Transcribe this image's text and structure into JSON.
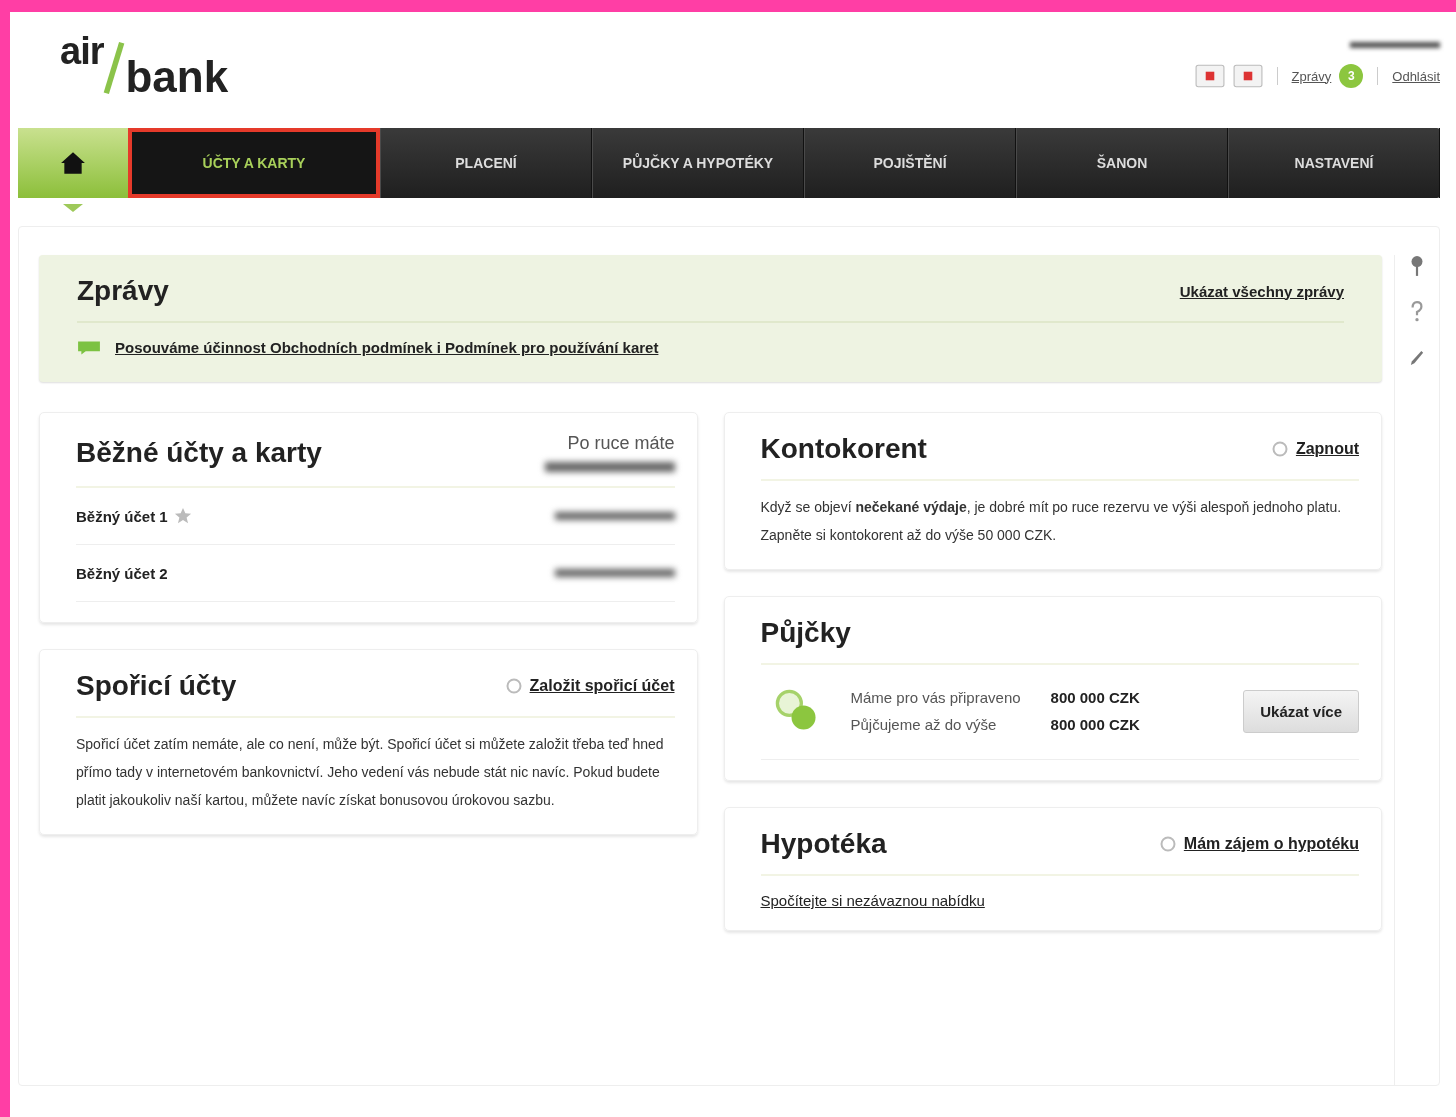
{
  "header": {
    "logo_top": "air",
    "logo_bottom": "bank",
    "messages_label": "Zprávy",
    "messages_count": "3",
    "logout": "Odhlásit"
  },
  "nav": [
    {
      "kind": "home",
      "selected": true,
      "highlighted": false
    },
    {
      "label": "ÚČTY A KARTY",
      "selected": false,
      "highlighted": true
    },
    {
      "label": "PLACENÍ",
      "selected": false,
      "highlighted": false
    },
    {
      "label": "PŮJČKY A HYPOTÉKY",
      "selected": false,
      "highlighted": false
    },
    {
      "label": "POJIŠTĚNÍ",
      "selected": false,
      "highlighted": false
    },
    {
      "label": "ŠANON",
      "selected": false,
      "highlighted": false
    },
    {
      "label": "NASTAVENÍ",
      "selected": false,
      "highlighted": false
    }
  ],
  "messages": {
    "title": "Zprávy",
    "link": "Ukázat všechny zprávy",
    "items": [
      "Posouváme účinnost Obchodních podmínek i Podmínek pro používání karet"
    ]
  },
  "current_accounts": {
    "title": "Běžné účty a karty",
    "available_label": "Po ruce máte",
    "accounts": [
      {
        "name": "Běžný účet 1",
        "favorite": true
      },
      {
        "name": "Běžný účet 2",
        "favorite": false
      }
    ]
  },
  "savings": {
    "title": "Spořicí účty",
    "action": "Založit spořicí účet",
    "text": "Spořicí účet zatím nemáte, ale co není, může být. Spořicí účet si můžete založit třeba teď hned přímo tady v internetovém bankovnictví. Jeho vedení vás nebude stát nic navíc. Pokud budete platit jakoukoliv naší kartou, můžete navíc získat bonusovou úrokovou sazbu."
  },
  "overdraft": {
    "title": "Kontokorent",
    "action": "Zapnout",
    "text": "Když se objeví **nečekané výdaje**, je dobré mít po ruce rezervu ve výši alespoň jednoho platu. Zapněte si kontokorent až do výše 50 000 CZK."
  },
  "loans": {
    "title": "Půjčky",
    "rows": [
      {
        "label": "Máme pro vás připraveno",
        "value": "800 000 CZK"
      },
      {
        "label": "Půjčujeme až do výše",
        "value": "800 000 CZK"
      }
    ],
    "button": "Ukázat více"
  },
  "mortgage": {
    "title": "Hypotéka",
    "action": "Mám zájem o hypotéku",
    "link": "Spočítejte si nezávaznou nabídku"
  }
}
